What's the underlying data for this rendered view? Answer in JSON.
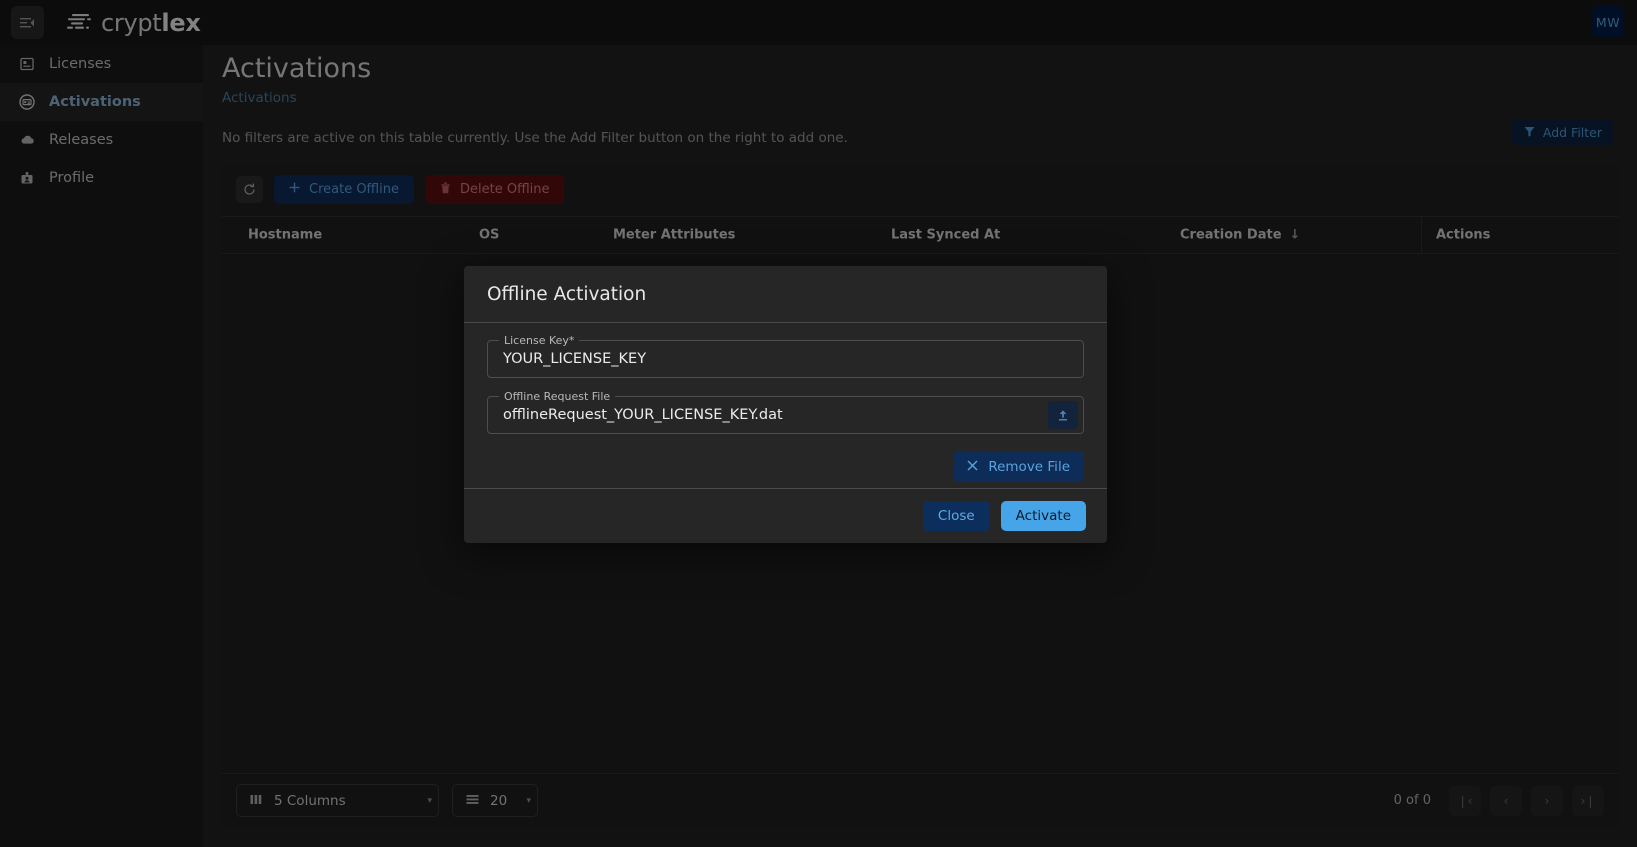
{
  "topbar": {
    "collapse_icon": "menu-collapse-icon",
    "brand_light": "crypt",
    "brand_bold": "lex",
    "avatar_initials": "MW"
  },
  "sidebar": {
    "items": [
      {
        "label": "Licenses",
        "icon": "license-card-icon",
        "active": false
      },
      {
        "label": "Activations",
        "icon": "activation-chip-icon",
        "active": true
      },
      {
        "label": "Releases",
        "icon": "cloud-icon",
        "active": false
      },
      {
        "label": "Profile",
        "icon": "profile-badge-icon",
        "active": false
      }
    ]
  },
  "page": {
    "title": "Activations",
    "breadcrumb": "Activations",
    "filter_note": "No filters are active on this table currently. Use the Add Filter button on the right to add one.",
    "add_filter_label": "Add Filter",
    "add_filter_icon": "filter-funnel-icon"
  },
  "toolbar": {
    "refresh_icon": "refresh-icon",
    "create_label": "Create Offline",
    "create_icon": "plus-icon",
    "delete_label": "Delete Offline",
    "delete_icon": "trash-icon"
  },
  "table": {
    "columns": [
      {
        "label": "Hostname",
        "sort": ""
      },
      {
        "label": "OS",
        "sort": ""
      },
      {
        "label": "Meter Attributes",
        "sort": ""
      },
      {
        "label": "Last Synced At",
        "sort": ""
      },
      {
        "label": "Creation Date",
        "sort": "↓"
      },
      {
        "label": "Actions",
        "sort": ""
      }
    ],
    "rows": []
  },
  "footer": {
    "columns_select": "5 Columns",
    "columns_icon": "columns-icon",
    "rows_select": "20",
    "rows_icon": "rows-icon",
    "caret": "▾",
    "page_count": "0 of 0",
    "first_icon": "❘‹",
    "prev_icon": "‹",
    "next_icon": "›",
    "last_icon": "›❘"
  },
  "dialog": {
    "title": "Offline Activation",
    "license_key_legend": "License Key*",
    "license_key_value": "YOUR_LICENSE_KEY",
    "request_file_legend": "Offline Request File",
    "request_file_value": "offlineRequest_YOUR_LICENSE_KEY.dat",
    "upload_icon": "upload-icon",
    "remove_file_label": "Remove File",
    "remove_file_icon": "close-x-icon",
    "close_label": "Close",
    "activate_label": "Activate"
  },
  "colors": {
    "accent_blue": "#45a5e8",
    "link_blue": "#5aa2e0",
    "danger_red": "#d87a7a",
    "panel_bg": "#1f1f1f",
    "page_bg": "#222222"
  }
}
